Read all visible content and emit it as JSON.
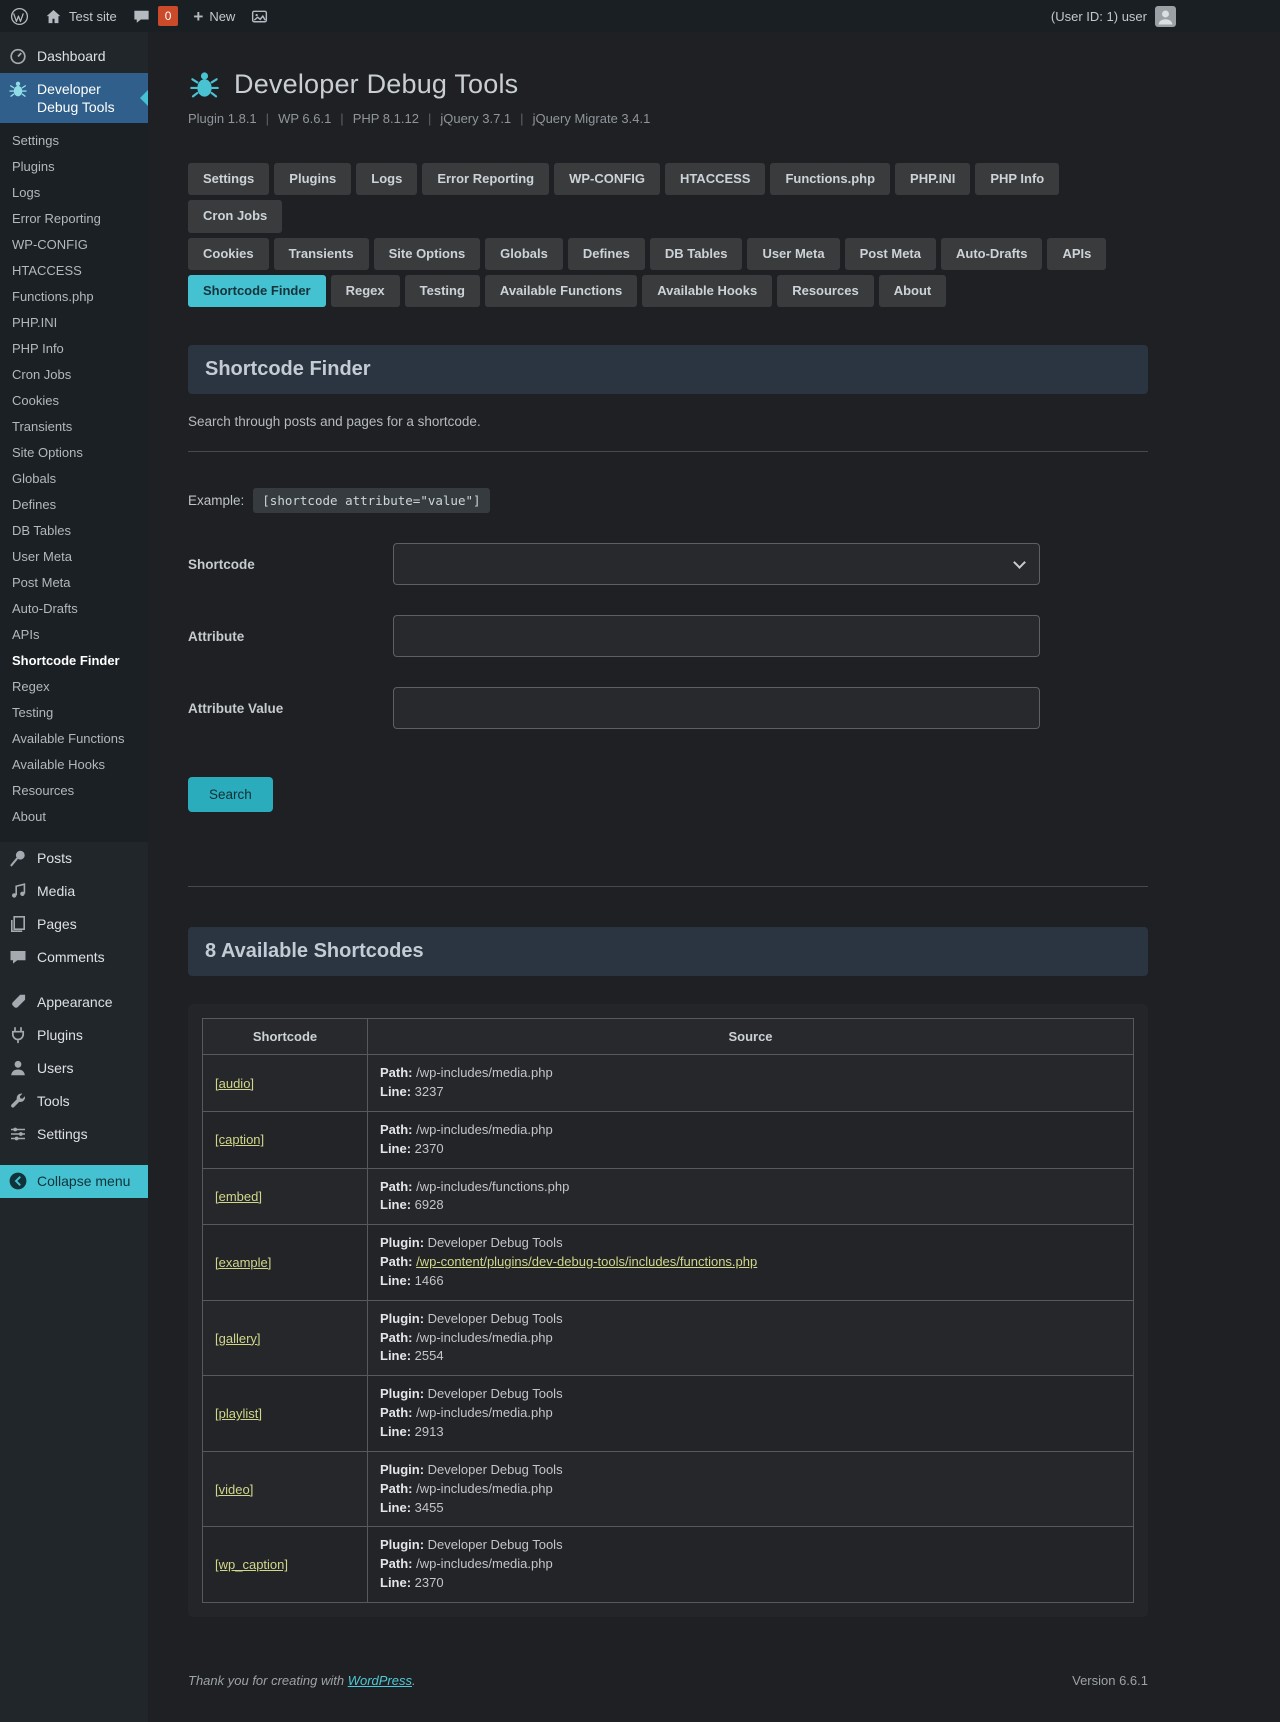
{
  "colors": {
    "accent_teal": "#45c2d1",
    "active_menu_blue": "#2f5f8a",
    "link_yellow": "#d1d78a",
    "badge_red": "#ca4a2a",
    "panel_header_bg": "#2b3441"
  },
  "admin_bar": {
    "site_name": "Test site",
    "comment_count": "0",
    "new_label": "New",
    "user_label": "(User ID: 1) user"
  },
  "sidebar": {
    "dashboard": "Dashboard",
    "plugin": "Developer Debug Tools",
    "submenu": [
      "Settings",
      "Plugins",
      "Logs",
      "Error Reporting",
      "WP-CONFIG",
      "HTACCESS",
      "Functions.php",
      "PHP.INI",
      "PHP Info",
      "Cron Jobs",
      "Cookies",
      "Transients",
      "Site Options",
      "Globals",
      "Defines",
      "DB Tables",
      "User Meta",
      "Post Meta",
      "Auto-Drafts",
      "APIs",
      "Shortcode Finder",
      "Regex",
      "Testing",
      "Available Functions",
      "Available Hooks",
      "Resources",
      "About"
    ],
    "current_submenu": "Shortcode Finder",
    "posts": "Posts",
    "media": "Media",
    "pages": "Pages",
    "comments": "Comments",
    "appearance": "Appearance",
    "plugins": "Plugins",
    "users": "Users",
    "tools": "Tools",
    "settings": "Settings",
    "collapse": "Collapse menu"
  },
  "header": {
    "title": "Developer Debug Tools",
    "meta": [
      "Plugin 1.8.1",
      "WP 6.6.1",
      "PHP 8.1.12",
      "jQuery 3.7.1",
      "jQuery Migrate 3.4.1"
    ]
  },
  "tabs": {
    "row1": [
      "Settings",
      "Plugins",
      "Logs",
      "Error Reporting",
      "WP-CONFIG",
      "HTACCESS",
      "Functions.php",
      "PHP.INI",
      "PHP Info",
      "Cron Jobs"
    ],
    "row2": [
      "Cookies",
      "Transients",
      "Site Options",
      "Globals",
      "Defines",
      "DB Tables",
      "User Meta",
      "Post Meta",
      "Auto-Drafts",
      "APIs"
    ],
    "row3": [
      "Shortcode Finder",
      "Regex",
      "Testing",
      "Available Functions",
      "Available Hooks",
      "Resources",
      "About"
    ],
    "active": "Shortcode Finder"
  },
  "finder": {
    "panel_title": "Shortcode Finder",
    "description": "Search through posts and pages for a shortcode.",
    "example_label": "Example:",
    "example_code": "[shortcode attribute=\"value\"]",
    "fields": [
      {
        "label": "Shortcode"
      },
      {
        "label": "Attribute"
      },
      {
        "label": "Attribute Value"
      }
    ],
    "search_label": "Search"
  },
  "results": {
    "panel_title": "8 Available Shortcodes",
    "columns": [
      "Shortcode",
      "Source"
    ],
    "rows": [
      {
        "shortcode": "[audio]",
        "source": [
          [
            "Path:",
            "/wp-includes/media.php"
          ],
          [
            "Line:",
            "3237"
          ]
        ]
      },
      {
        "shortcode": "[caption]",
        "source": [
          [
            "Path:",
            "/wp-includes/media.php"
          ],
          [
            "Line:",
            "2370"
          ]
        ]
      },
      {
        "shortcode": "[embed]",
        "source": [
          [
            "Path:",
            "/wp-includes/functions.php"
          ],
          [
            "Line:",
            "6928"
          ]
        ]
      },
      {
        "shortcode": "[example]",
        "source": [
          [
            "Plugin:",
            "Developer Debug Tools"
          ],
          [
            "Path:",
            "/wp-content/plugins/dev-debug-tools/includes/functions.php",
            "link"
          ],
          [
            "Line:",
            "1466"
          ]
        ]
      },
      {
        "shortcode": "[gallery]",
        "source": [
          [
            "Plugin:",
            "Developer Debug Tools"
          ],
          [
            "Path:",
            "/wp-includes/media.php"
          ],
          [
            "Line:",
            "2554"
          ]
        ]
      },
      {
        "shortcode": "[playlist]",
        "source": [
          [
            "Plugin:",
            "Developer Debug Tools"
          ],
          [
            "Path:",
            "/wp-includes/media.php"
          ],
          [
            "Line:",
            "2913"
          ]
        ]
      },
      {
        "shortcode": "[video]",
        "source": [
          [
            "Plugin:",
            "Developer Debug Tools"
          ],
          [
            "Path:",
            "/wp-includes/media.php"
          ],
          [
            "Line:",
            "3455"
          ]
        ]
      },
      {
        "shortcode": "[wp_caption]",
        "source": [
          [
            "Plugin:",
            "Developer Debug Tools"
          ],
          [
            "Path:",
            "/wp-includes/media.php"
          ],
          [
            "Line:",
            "2370"
          ]
        ]
      }
    ]
  },
  "footer": {
    "thanks_prefix": "Thank you for creating with ",
    "link": "WordPress",
    "suffix": ".",
    "version": "Version 6.6.1"
  },
  "icons": [
    "wordpress-logo-icon",
    "home-icon",
    "comment-icon",
    "plus-icon",
    "image-icon",
    "dashboard-icon",
    "bug-icon",
    "pin-icon",
    "media-note-icon",
    "pages-icon",
    "comments-bubble-icon",
    "appearance-brush-icon",
    "plugins-plug-icon",
    "users-icon",
    "tools-wrench-icon",
    "settings-sliders-icon",
    "collapse-arrow-icon",
    "chevron-down-icon",
    "avatar"
  ]
}
